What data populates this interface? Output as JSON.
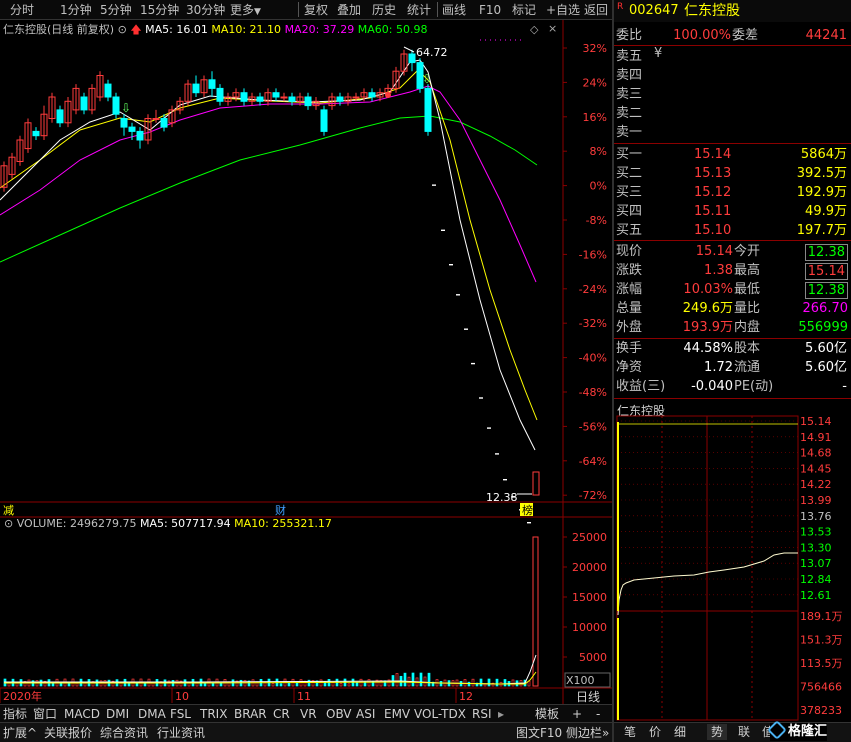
{
  "colors": {
    "up": "#ff3c3c",
    "down": "#00ffff",
    "ma5": "#ffffff",
    "ma10": "#ffff00",
    "ma20": "#ff00ff",
    "ma60": "#00ff00",
    "grid": "#8b0000",
    "text": "#c0c0c0"
  },
  "toolbar": {
    "items": [
      "分时",
      "1分钟",
      "5分钟",
      "15分钟",
      "30分钟",
      "更多"
    ],
    "right_items": [
      "复权",
      "叠加",
      "历史",
      "统计",
      "画线",
      "F10",
      "标记",
      "+自选",
      "返回"
    ]
  },
  "chart": {
    "title": "仁东控股(日线 前复权)",
    "ma5_label": "MA5: 16.01",
    "ma10_label": "MA10: 21.10",
    "ma20_label": "MA20: 37.29",
    "ma60_label": "MA60: 50.98",
    "y_ticks": [
      "32%",
      "24%",
      "16%",
      "8%",
      "0%",
      "-8%",
      "-16%",
      "-24%",
      "-32%",
      "-40%",
      "-48%",
      "-56%",
      "-64%",
      "-72%"
    ],
    "high_label": "64.72",
    "low_label": "12.38",
    "marks": {
      "left": "减",
      "center": "财",
      "right": "榜"
    }
  },
  "volume": {
    "label": "VOLUME: 2496279.75",
    "ma5_label": "MA5: 507717.94",
    "ma10_label": "MA10: 255321.17",
    "y_ticks": [
      "25000",
      "20000",
      "15000",
      "10000",
      "5000"
    ],
    "unit": "X100"
  },
  "x_axis": {
    "labels": [
      "2020年",
      "10",
      "11",
      "12"
    ],
    "period": "日线"
  },
  "bottom_tabs": [
    "指标",
    "窗口",
    "MACD",
    "DMI",
    "DMA",
    "FSL",
    "TRIX",
    "BRAR",
    "CR",
    "VR",
    "OBV",
    "ASI",
    "EMV",
    "VOL-TDX",
    "RSI"
  ],
  "bottom_right": {
    "template": "模板",
    "plus": "+",
    "minus": "-"
  },
  "status_bar": {
    "items": [
      "扩展^",
      "关联报价",
      "综合资讯",
      "行业资讯"
    ],
    "right": "图文F10",
    "side": "侧边栏»"
  },
  "quote": {
    "flag": "R",
    "code": "002647",
    "name": "仁东控股",
    "ratio_label": "委比",
    "ratio_value": "100.00%",
    "diff_label": "委差",
    "diff_value": "44241",
    "sell": [
      {
        "label": "卖五",
        "price": "¥",
        "vol": ""
      },
      {
        "label": "卖四",
        "price": "",
        "vol": ""
      },
      {
        "label": "卖三",
        "price": "",
        "vol": ""
      },
      {
        "label": "卖二",
        "price": "",
        "vol": ""
      },
      {
        "label": "卖一",
        "price": "",
        "vol": ""
      }
    ],
    "buy": [
      {
        "label": "买一",
        "price": "15.14",
        "vol": "5864万"
      },
      {
        "label": "买二",
        "price": "15.13",
        "vol": "392.5万"
      },
      {
        "label": "买三",
        "price": "15.12",
        "vol": "192.9万"
      },
      {
        "label": "买四",
        "price": "15.11",
        "vol": "49.9万"
      },
      {
        "label": "买五",
        "price": "15.10",
        "vol": "197.7万"
      }
    ],
    "stats": [
      {
        "l1": "现价",
        "v1": "15.14",
        "l2": "今开",
        "v2": "12.38"
      },
      {
        "l1": "涨跌",
        "v1": "1.38",
        "l2": "最高",
        "v2": "15.14"
      },
      {
        "l1": "涨幅",
        "v1": "10.03%",
        "l2": "最低",
        "v2": "12.38"
      },
      {
        "l1": "总量",
        "v1": "249.6万",
        "l2": "量比",
        "v2": "266.70"
      },
      {
        "l1": "外盘",
        "v1": "193.9万",
        "l2": "内盘",
        "v2": "556999"
      }
    ],
    "stats2": [
      {
        "l1": "换手",
        "v1": "44.58%",
        "l2": "股本",
        "v2": "5.60亿"
      },
      {
        "l1": "净资",
        "v1": "1.72",
        "l2": "流通",
        "v2": "5.60亿"
      },
      {
        "l1": "收益(三)",
        "v1": "-0.040",
        "l2": "PE(动)",
        "v2": "-"
      }
    ]
  },
  "mini_chart": {
    "title": "仁东控股",
    "price_ticks": [
      "15.14",
      "14.91",
      "14.68",
      "14.45",
      "14.22",
      "13.99",
      "13.76",
      "13.53",
      "13.30",
      "13.07",
      "12.84",
      "12.61"
    ],
    "vol_ticks": [
      "189.1万",
      "151.3万",
      "113.5万",
      "756466",
      "378233"
    ]
  },
  "right_tabs": [
    "笔",
    "价",
    "细",
    "势",
    "联",
    "值"
  ],
  "watermark": "格隆汇"
}
